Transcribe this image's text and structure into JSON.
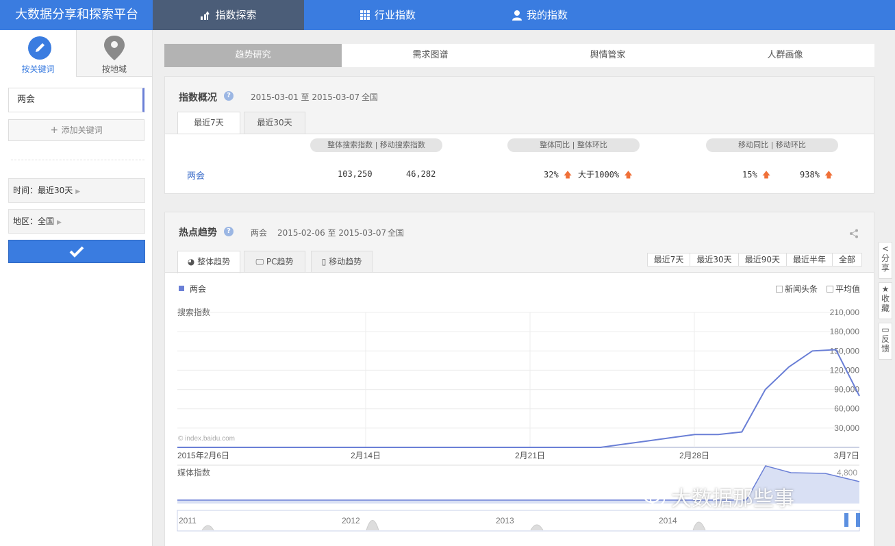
{
  "brand": "大数据分享和探索平台",
  "nav": {
    "tabs": [
      {
        "label": "指数探索",
        "icon": "trend-icon"
      },
      {
        "label": "行业指数",
        "icon": "grid-icon"
      },
      {
        "label": "我的指数",
        "icon": "user-icon"
      }
    ]
  },
  "sidebar": {
    "tab_keyword": "按关键词",
    "tab_area": "按地域",
    "keyword": "两会",
    "add_keyword": "添加关键词",
    "time_label": "时间：最近30天",
    "area_label": "地区：全国"
  },
  "subtabs": [
    "趋势研究",
    "需求图谱",
    "舆情管家",
    "人群画像"
  ],
  "overview": {
    "title": "指数概况",
    "date_range": "2015-03-01 至 2015-03-07",
    "region": "全国",
    "tabs": [
      "最近7天",
      "最近30天"
    ],
    "pill1": "整体搜索指数 | 移动搜索指数",
    "pill2": "整体同比 | 整体环比",
    "pill3": "移动同比 | 移动环比",
    "keyword": "两会",
    "total_search": "103,250",
    "mobile_search": "46,282",
    "total_yoy": "32%",
    "total_mom": "大于1000%",
    "mobile_yoy": "15%",
    "mobile_mom": "938%"
  },
  "hot": {
    "title": "热点趋势",
    "keyword": "两会",
    "date_range": "2015-02-06 至 2015-03-07",
    "region": "全国",
    "tabs": [
      "整体趋势",
      "PC趋势",
      "移动趋势"
    ],
    "ranges": [
      "最近7天",
      "最近30天",
      "最近90天",
      "最近半年",
      "全部"
    ],
    "legend": "两会",
    "opt_news": "新闻头条",
    "opt_avg": "平均值",
    "search_label": "搜索指数",
    "media_label": "媒体指数",
    "copyright": "© index.baidu.com",
    "media_tick": "4,800"
  },
  "chart_data": {
    "type": "line",
    "ylabel": "搜索指数",
    "ylim": [
      0,
      210000
    ],
    "y_ticks": [
      "210,000",
      "180,000",
      "150,000",
      "120,000",
      "90,000",
      "60,000",
      "30,000"
    ],
    "x_ticks": [
      "2015年2月6日",
      "2月14日",
      "2月21日",
      "2月28日",
      "3月7日"
    ],
    "series": [
      {
        "name": "两会",
        "x": [
          "2015-02-06",
          "2015-02-07",
          "2015-02-08",
          "2015-02-09",
          "2015-02-10",
          "2015-02-11",
          "2015-02-12",
          "2015-02-13",
          "2015-02-14",
          "2015-02-15",
          "2015-02-16",
          "2015-02-17",
          "2015-02-18",
          "2015-02-19",
          "2015-02-20",
          "2015-02-21",
          "2015-02-22",
          "2015-02-23",
          "2015-02-24",
          "2015-02-25",
          "2015-02-26",
          "2015-02-27",
          "2015-02-28",
          "2015-03-01",
          "2015-03-02",
          "2015-03-03",
          "2015-03-04",
          "2015-03-05",
          "2015-03-06",
          "2015-03-07"
        ],
        "values": [
          0,
          0,
          0,
          0,
          0,
          0,
          0,
          0,
          0,
          0,
          0,
          0,
          0,
          0,
          0,
          0,
          0,
          0,
          0,
          5000,
          10000,
          15000,
          20000,
          20000,
          24000,
          90000,
          125000,
          150000,
          152000,
          80000
        ]
      }
    ],
    "overview_years": [
      "2011",
      "2012",
      "2013",
      "2014"
    ]
  },
  "float_tools": [
    "分享",
    "收藏",
    "反馈"
  ],
  "watermark": "大数据那些事",
  "colors": {
    "accent": "#3a7ce0",
    "line": "#6a7fd6",
    "up": "#f07038"
  }
}
